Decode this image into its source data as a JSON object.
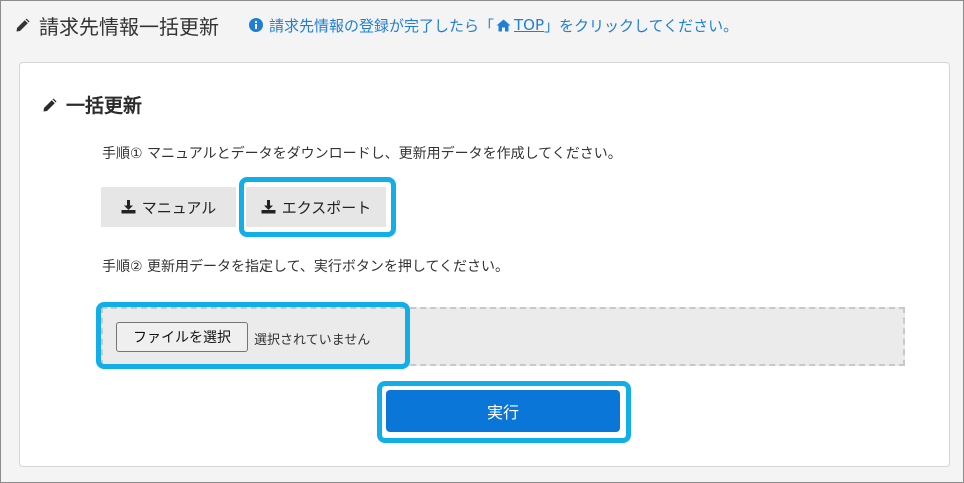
{
  "header": {
    "title": "請求先情報一括更新",
    "note_prefix": "請求先情報の登録が完了したら「",
    "top_link": "TOP",
    "note_suffix": "」をクリックしてください。"
  },
  "card": {
    "title": "一括更新",
    "step1": "手順① マニュアルとデータをダウンロードし、更新用データを作成してください。",
    "manual_button": "マニュアル",
    "export_button": "エクスポート",
    "step2": "手順② 更新用データを指定して、実行ボタンを押してください。",
    "file_button": "ファイルを選択",
    "file_status": "選択されていません",
    "execute_button": "実行"
  },
  "icons": {
    "pencil": "pencil-icon",
    "info": "info-circle-icon",
    "home": "home-icon",
    "download": "download-icon"
  },
  "colors": {
    "accent": "#1f7fd6",
    "primary_button": "#0a76d8",
    "highlight": "#12aee8"
  }
}
